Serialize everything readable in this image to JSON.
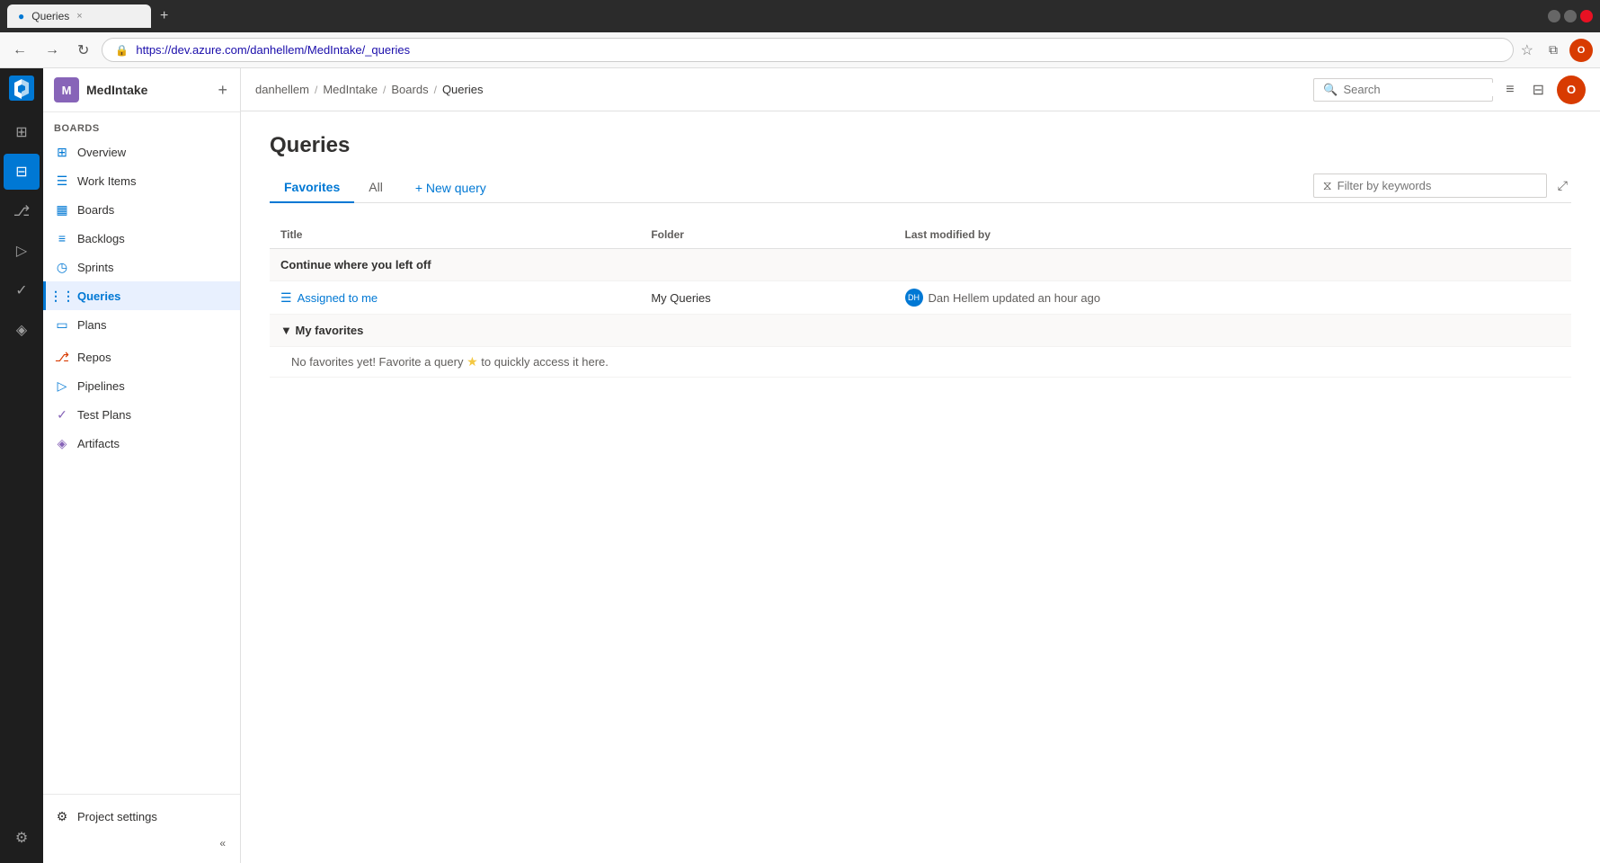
{
  "browser": {
    "tab_title": "Queries",
    "tab_close": "×",
    "url": "https://dev.azure.com/danhellem/MedIntake/_queries",
    "new_tab_icon": "+",
    "back_icon": "←",
    "forward_icon": "→",
    "refresh_icon": "↻",
    "fav_icon": "☆",
    "extensions_icon": "⧉",
    "profile_initials": "O"
  },
  "left_rail": {
    "logo_color": "#0078d4",
    "items": [
      {
        "id": "overview",
        "icon": "⊞",
        "label": "Overview"
      },
      {
        "id": "boards",
        "icon": "⊟",
        "label": "Boards",
        "active": true
      },
      {
        "id": "repos",
        "icon": "⎇",
        "label": "Repos"
      },
      {
        "id": "pipelines",
        "icon": "▷",
        "label": "Pipelines"
      },
      {
        "id": "testplans",
        "icon": "✓",
        "label": "Test Plans"
      },
      {
        "id": "artifacts",
        "icon": "◈",
        "label": "Artifacts"
      }
    ],
    "settings_icon": "⚙",
    "settings_label": "Project settings"
  },
  "sidebar": {
    "project_icon_text": "M",
    "project_name": "MedIntake",
    "add_button_label": "+",
    "sections": [
      {
        "header": "Boards",
        "items": [
          {
            "id": "overview",
            "icon": "⊞",
            "label": "Overview",
            "active": false
          },
          {
            "id": "work-items",
            "icon": "☰",
            "label": "Work Items",
            "active": false
          },
          {
            "id": "boards",
            "icon": "▦",
            "label": "Boards",
            "active": false
          },
          {
            "id": "backlogs",
            "icon": "≡",
            "label": "Backlogs",
            "active": false
          },
          {
            "id": "sprints",
            "icon": "◷",
            "label": "Sprints",
            "active": false
          },
          {
            "id": "queries",
            "icon": "⋮",
            "label": "Queries",
            "active": true
          },
          {
            "id": "plans",
            "icon": "▭",
            "label": "Plans",
            "active": false
          }
        ]
      }
    ],
    "repos_label": "Repos",
    "pipelines_label": "Pipelines",
    "testplans_label": "Test Plans",
    "artifacts_label": "Artifacts",
    "project_settings_label": "Project settings",
    "collapse_label": "«"
  },
  "top_nav": {
    "breadcrumbs": [
      {
        "label": "danhellem",
        "id": "bc-danhellem"
      },
      {
        "label": "MedIntake",
        "id": "bc-medintake"
      },
      {
        "label": "Boards",
        "id": "bc-boards"
      },
      {
        "label": "Queries",
        "id": "bc-queries"
      }
    ],
    "search_placeholder": "Search",
    "search_icon": "🔍",
    "notifications_icon": "≡",
    "basket_icon": "⊟",
    "profile_initials": "O"
  },
  "content": {
    "page_title": "Queries",
    "tabs": [
      {
        "id": "favorites",
        "label": "Favorites",
        "active": true
      },
      {
        "id": "all",
        "label": "All",
        "active": false
      }
    ],
    "new_query_button": "+ New query",
    "filter_placeholder": "Filter by keywords",
    "filter_icon": "⧖",
    "expand_icon": "⤢",
    "table_headers": {
      "title": "Title",
      "folder": "Folder",
      "last_modified": "Last modified by"
    },
    "sections": [
      {
        "id": "continue",
        "label": "Continue where you left off",
        "items": [
          {
            "id": "assigned-to-me",
            "icon": "☰",
            "title": "Assigned to me",
            "folder": "My Queries",
            "avatar_initials": "DH",
            "modified_text": "Dan Hellem updated an hour ago"
          }
        ]
      },
      {
        "id": "my-favorites",
        "label": "My favorites",
        "collapse_icon": "▼",
        "items": [],
        "empty_message_before": "No favorites yet! Favorite a query ",
        "star_icon": "★",
        "empty_message_after": " to quickly access it here."
      }
    ]
  }
}
